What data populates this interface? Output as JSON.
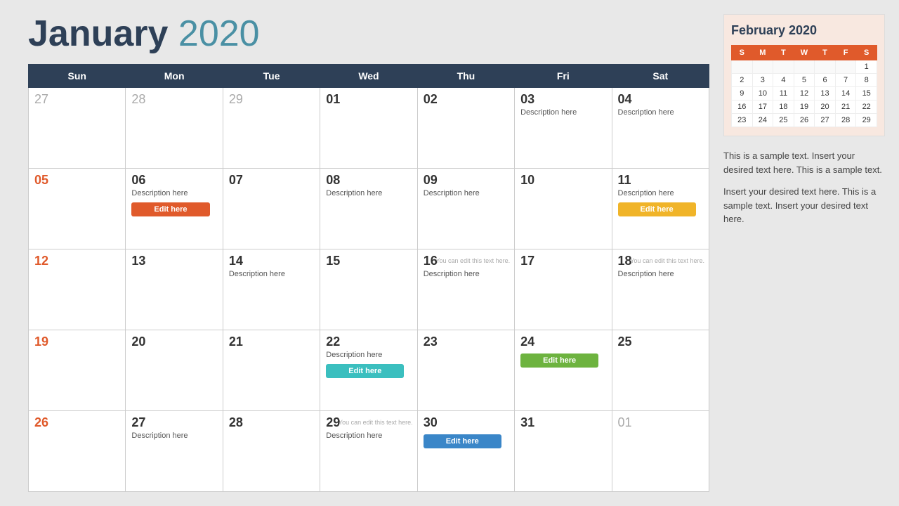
{
  "header": {
    "title_month": "January",
    "title_year": "2020"
  },
  "days_of_week": [
    "Sun",
    "Mon",
    "Tue",
    "Wed",
    "Thu",
    "Fri",
    "Sat"
  ],
  "weeks": [
    [
      {
        "num": "27",
        "type": "other-month",
        "desc": "",
        "btn": null,
        "hint": null
      },
      {
        "num": "28",
        "type": "other-month",
        "desc": "",
        "btn": null,
        "hint": null
      },
      {
        "num": "29",
        "type": "other-month",
        "desc": "",
        "btn": null,
        "hint": null
      },
      {
        "num": "01",
        "type": "normal",
        "desc": "",
        "btn": null,
        "hint": null
      },
      {
        "num": "02",
        "type": "normal",
        "desc": "",
        "btn": null,
        "hint": null
      },
      {
        "num": "03",
        "type": "normal",
        "desc": "Description here",
        "btn": null,
        "hint": null
      },
      {
        "num": "04",
        "type": "normal",
        "desc": "Description here",
        "btn": null,
        "hint": null
      }
    ],
    [
      {
        "num": "05",
        "type": "sunday",
        "desc": "",
        "btn": null,
        "hint": null
      },
      {
        "num": "06",
        "type": "normal",
        "desc": "Description here",
        "btn": {
          "label": "Edit here",
          "color": "orange"
        },
        "hint": null
      },
      {
        "num": "07",
        "type": "normal",
        "desc": "",
        "btn": null,
        "hint": null
      },
      {
        "num": "08",
        "type": "normal",
        "desc": "Description here",
        "btn": null,
        "hint": null
      },
      {
        "num": "09",
        "type": "normal",
        "desc": "Description here",
        "btn": null,
        "hint": null
      },
      {
        "num": "10",
        "type": "normal",
        "desc": "",
        "btn": null,
        "hint": null
      },
      {
        "num": "11",
        "type": "normal",
        "desc": "Description here",
        "btn": {
          "label": "Edit here",
          "color": "yellow"
        },
        "hint": null
      }
    ],
    [
      {
        "num": "12",
        "type": "sunday",
        "desc": "",
        "btn": null,
        "hint": null
      },
      {
        "num": "13",
        "type": "normal",
        "desc": "",
        "btn": null,
        "hint": null
      },
      {
        "num": "14",
        "type": "normal",
        "desc": "Description here",
        "btn": null,
        "hint": null
      },
      {
        "num": "15",
        "type": "normal",
        "desc": "",
        "btn": null,
        "hint": null
      },
      {
        "num": "16",
        "type": "normal",
        "desc": "Description here",
        "btn": null,
        "hint": "You can edit this text here."
      },
      {
        "num": "17",
        "type": "normal",
        "desc": "",
        "btn": null,
        "hint": null
      },
      {
        "num": "18",
        "type": "normal",
        "desc": "Description here",
        "btn": null,
        "hint": "You can edit this text here."
      }
    ],
    [
      {
        "num": "19",
        "type": "sunday",
        "desc": "",
        "btn": null,
        "hint": null
      },
      {
        "num": "20",
        "type": "normal",
        "desc": "",
        "btn": null,
        "hint": null
      },
      {
        "num": "21",
        "type": "normal",
        "desc": "",
        "btn": null,
        "hint": null
      },
      {
        "num": "22",
        "type": "normal",
        "desc": "Description here",
        "btn": {
          "label": "Edit here",
          "color": "teal"
        },
        "hint": null
      },
      {
        "num": "23",
        "type": "normal",
        "desc": "",
        "btn": null,
        "hint": null
      },
      {
        "num": "24",
        "type": "normal",
        "desc": "",
        "btn": {
          "label": "Edit here",
          "color": "green"
        },
        "hint": null
      },
      {
        "num": "25",
        "type": "normal",
        "desc": "",
        "btn": null,
        "hint": null
      }
    ],
    [
      {
        "num": "26",
        "type": "sunday",
        "desc": "",
        "btn": null,
        "hint": null
      },
      {
        "num": "27",
        "type": "normal",
        "desc": "Description here",
        "btn": null,
        "hint": null
      },
      {
        "num": "28",
        "type": "normal",
        "desc": "",
        "btn": null,
        "hint": null
      },
      {
        "num": "29",
        "type": "normal",
        "desc": "Description here",
        "btn": null,
        "hint": "You can edit this text here."
      },
      {
        "num": "30",
        "type": "normal",
        "desc": "",
        "btn": {
          "label": "Edit here",
          "color": "blue"
        },
        "hint": null
      },
      {
        "num": "31",
        "type": "normal",
        "desc": "",
        "btn": null,
        "hint": null
      },
      {
        "num": "01",
        "type": "other-month",
        "desc": "",
        "btn": null,
        "hint": null
      }
    ]
  ],
  "sidebar": {
    "mini_cal_title": "February 2020",
    "mini_cal_headers": [
      "S",
      "M",
      "T",
      "W",
      "T",
      "F",
      "S"
    ],
    "mini_cal_weeks": [
      [
        "",
        "",
        "",
        "",
        "",
        "",
        "1"
      ],
      [
        "2",
        "3",
        "4",
        "5",
        "6",
        "7",
        "8"
      ],
      [
        "9",
        "10",
        "11",
        "12",
        "13",
        "14",
        "15"
      ],
      [
        "16",
        "17",
        "18",
        "19",
        "20",
        "21",
        "22"
      ],
      [
        "23",
        "24",
        "25",
        "26",
        "27",
        "28",
        "29"
      ]
    ],
    "text1": "This is a sample text. Insert your desired text here. This is a sample text.",
    "text2": "Insert your desired text here. This is a sample text. Insert your desired text here."
  }
}
